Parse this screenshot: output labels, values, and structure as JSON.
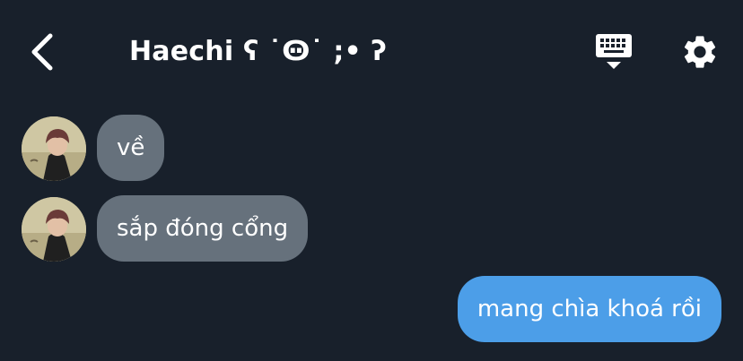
{
  "header": {
    "back_icon": "chevron-left-icon",
    "title": "Haechi ʕ ˙Ꙫ˙ ;• ʔ",
    "keyboard_icon": "keyboard-icon",
    "settings_icon": "gear-icon"
  },
  "messages": [
    {
      "direction": "incoming",
      "text": "về"
    },
    {
      "direction": "incoming",
      "text": "sắp đóng cổng"
    },
    {
      "direction": "outgoing",
      "text": "mang chìa khoá rồi"
    }
  ],
  "colors": {
    "background": "#18202b",
    "incoming_bubble": "#66717c",
    "outgoing_bubble": "#4c9ee8"
  }
}
